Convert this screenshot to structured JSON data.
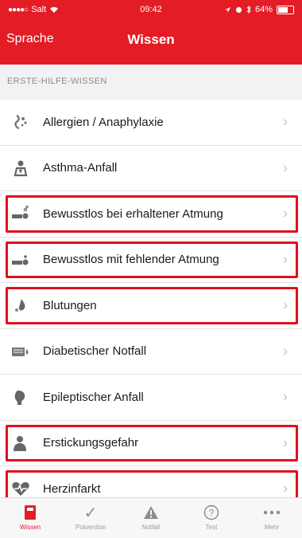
{
  "status": {
    "carrier": "Salt",
    "time": "09:42",
    "battery": "64%"
  },
  "nav": {
    "back": "Sprache",
    "title": "Wissen"
  },
  "section": "ERSTE-HILFE-WISSEN",
  "items": [
    {
      "label": "Allergien / Anaphylaxie",
      "icon": "allergy-icon",
      "highlight": false
    },
    {
      "label": "Asthma-Anfall",
      "icon": "asthma-icon",
      "highlight": false
    },
    {
      "label": "Bewusstlos bei erhaltener Atmung",
      "icon": "unconscious-breathing-icon",
      "highlight": true
    },
    {
      "label": "Bewusstlos mit fehlender Atmung",
      "icon": "unconscious-not-breathing-icon",
      "highlight": true
    },
    {
      "label": "Blutungen",
      "icon": "bleeding-icon",
      "highlight": true
    },
    {
      "label": "Diabetischer Notfall",
      "icon": "diabetes-icon",
      "highlight": false
    },
    {
      "label": "Epileptischer Anfall",
      "icon": "epilepsy-icon",
      "highlight": false
    },
    {
      "label": "Erstickungsgefahr",
      "icon": "choking-icon",
      "highlight": true
    },
    {
      "label": "Herzinfarkt",
      "icon": "heart-icon",
      "highlight": true
    }
  ],
  "tabs": [
    {
      "label": "Wissen",
      "icon": "book-icon",
      "active": true
    },
    {
      "label": "Prävention",
      "icon": "checkmark-icon",
      "active": false
    },
    {
      "label": "Notfall",
      "icon": "warning-icon",
      "active": false
    },
    {
      "label": "Test",
      "icon": "question-icon",
      "active": false
    },
    {
      "label": "Mehr",
      "icon": "more-icon",
      "active": false
    }
  ],
  "colors": {
    "accent": "#e31c25",
    "highlight_border": "#e0101e"
  }
}
